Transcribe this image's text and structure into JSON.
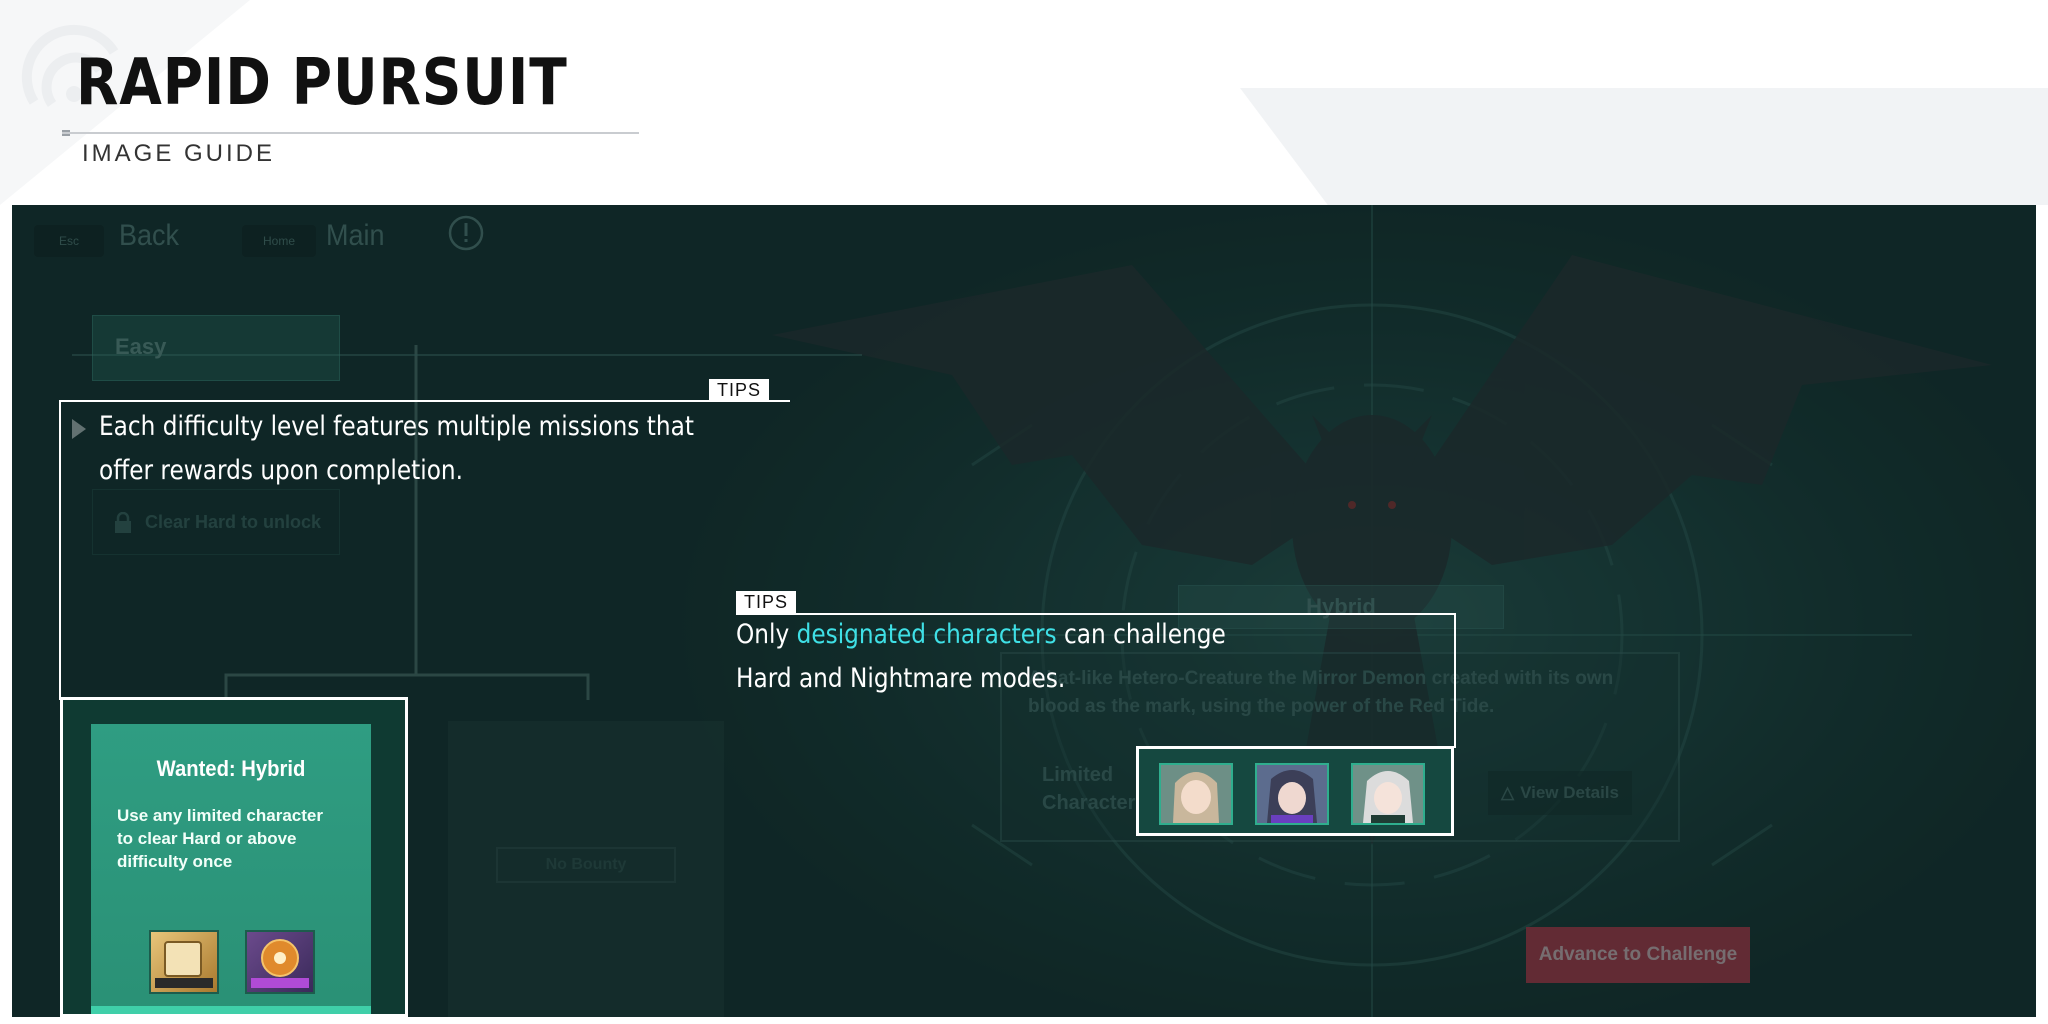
{
  "header": {
    "title": "RAPID PURSUIT",
    "subtitle": "IMAGE GUIDE"
  },
  "game": {
    "topbar": {
      "back_key": "Esc",
      "back_label": "Back",
      "main_key": "Home",
      "main_label": "Main"
    },
    "difficulty": {
      "easy_label": "Easy",
      "locked_label": "Clear Hard to unlock"
    },
    "mission_card": {
      "title": "Wanted: Hybrid",
      "description": "Use any limited character to clear Hard or above difficulty once"
    },
    "empty_card": {
      "status": "No Bounty"
    },
    "enemy": {
      "name": "Hybrid",
      "description": "A bat-like Hetero-Creature the Mirror Demon created with its own blood as the mark, using the power of the Red Tide.",
      "limited_label": "Limited Characters",
      "view_details": "View Details",
      "advance_button": "Advance to Challenge"
    },
    "colors": {
      "scene_bg": "#173532",
      "mission_green": "#2e9c80",
      "advance_red": "#c9354a",
      "highlight_cyan": "#3fe0e6"
    }
  },
  "tips": [
    {
      "label": "TIPS",
      "text": "Each difficulty level features multiple missions that offer rewards upon completion."
    },
    {
      "label": "TIPS",
      "text_before": "Only ",
      "text_highlight": "designated characters",
      "text_after": " can challenge Hard and Nightmare modes."
    }
  ]
}
